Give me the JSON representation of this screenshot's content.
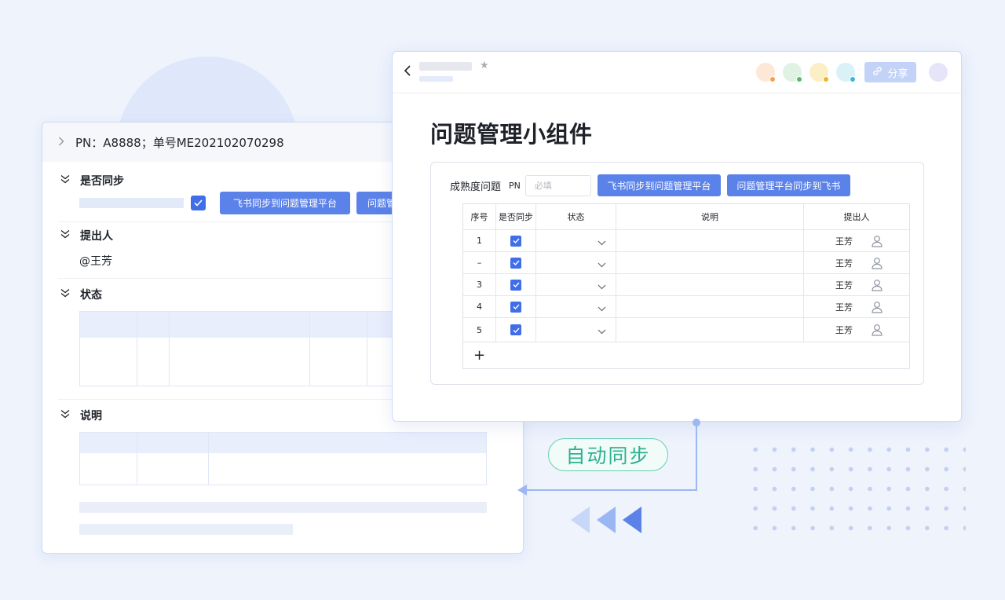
{
  "doc_card": {
    "header_title": "PN：A8888；单号ME202102070298",
    "sections": {
      "sync": "是否同步",
      "proposer": "提出人",
      "status": "状态",
      "desc": "说明"
    },
    "sync_buttons": [
      "飞书同步到问题管理平台",
      "问题管"
    ],
    "proposer_value": "@王芳"
  },
  "widget_card": {
    "title": "问题管理小组件",
    "share_label": "分享",
    "form": {
      "label": "成熟度问题",
      "pn_label": "PN",
      "pn_placeholder": "必填",
      "btn_to_platform": "飞书同步到问题管理平台",
      "btn_to_feishu": "问题管理平台同步到飞书"
    },
    "table": {
      "headers": [
        "序号",
        "是否同步",
        "状态",
        "说明",
        "提出人"
      ],
      "rows": [
        {
          "index": "1",
          "synced": true,
          "proposer": "王芳"
        },
        {
          "index": "–",
          "synced": true,
          "proposer": "王芳"
        },
        {
          "index": "3",
          "synced": true,
          "proposer": "王芳"
        },
        {
          "index": "4",
          "synced": true,
          "proposer": "王芳"
        },
        {
          "index": "5",
          "synced": true,
          "proposer": "王芳"
        }
      ],
      "add_label": "+"
    }
  },
  "sync_label": "自动同步",
  "colors": {
    "primary": "#5b82e9",
    "checkbox": "#3f6ee8",
    "sync_green": "#2fb08f",
    "connector": "#9db7f3",
    "page_bg": "#eef3fc"
  }
}
